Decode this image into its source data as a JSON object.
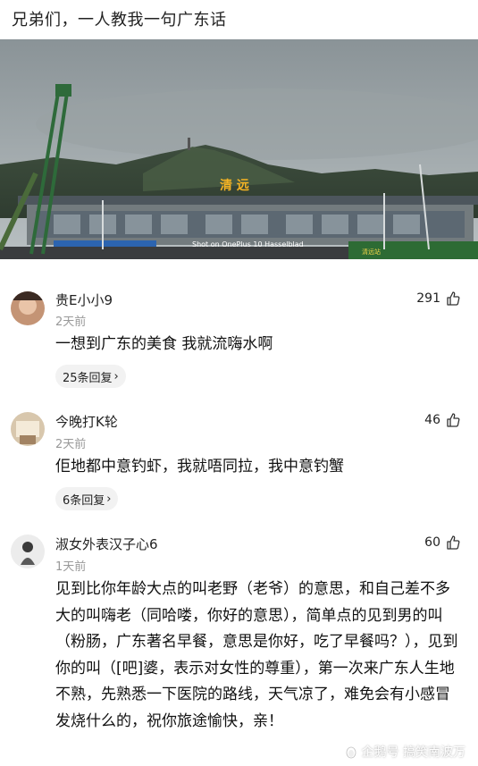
{
  "post": {
    "title": "兄弟们，一人教我一句广东话"
  },
  "photo": {
    "sign_text": "清 远",
    "caption": "Shot on OnePlus 10  Hasselblad",
    "corner_text": "清远站"
  },
  "comments": [
    {
      "user": "贵E小小9",
      "time": "2天前",
      "likes": "291",
      "text": "一想到广东的美食  我就流嗨水啊",
      "replies": "25条回复",
      "reply_arrow": "›"
    },
    {
      "user": "今晚打K轮",
      "time": "2天前",
      "likes": "46",
      "text": "佢地都中意钓虾，我就唔同拉，我中意钓蟹",
      "replies": "6条回复",
      "reply_arrow": "›"
    },
    {
      "user": "淑女外表汉子心6",
      "time": "1天前",
      "likes": "60",
      "text": "见到比你年龄大点的叫老野（老爷）的意思，和自己差不多大的叫嗨老（同哈喽，你好的意思），简单点的见到男的叫（粉肠，广东著名早餐，意思是你好，吃了早餐吗？），见到你的叫（[吧]婆，表示对女性的尊重），第一次来广东人生地不熟，先熟悉一下医院的路线，天气凉了，难免会有小感冒发烧什么的，祝你旅途愉快，亲！"
    }
  ],
  "watermark": {
    "text": "企鹅号 搞笑南波万"
  },
  "icons": {
    "like": "thumbs-up-icon",
    "watermark": "penguin-icon"
  }
}
